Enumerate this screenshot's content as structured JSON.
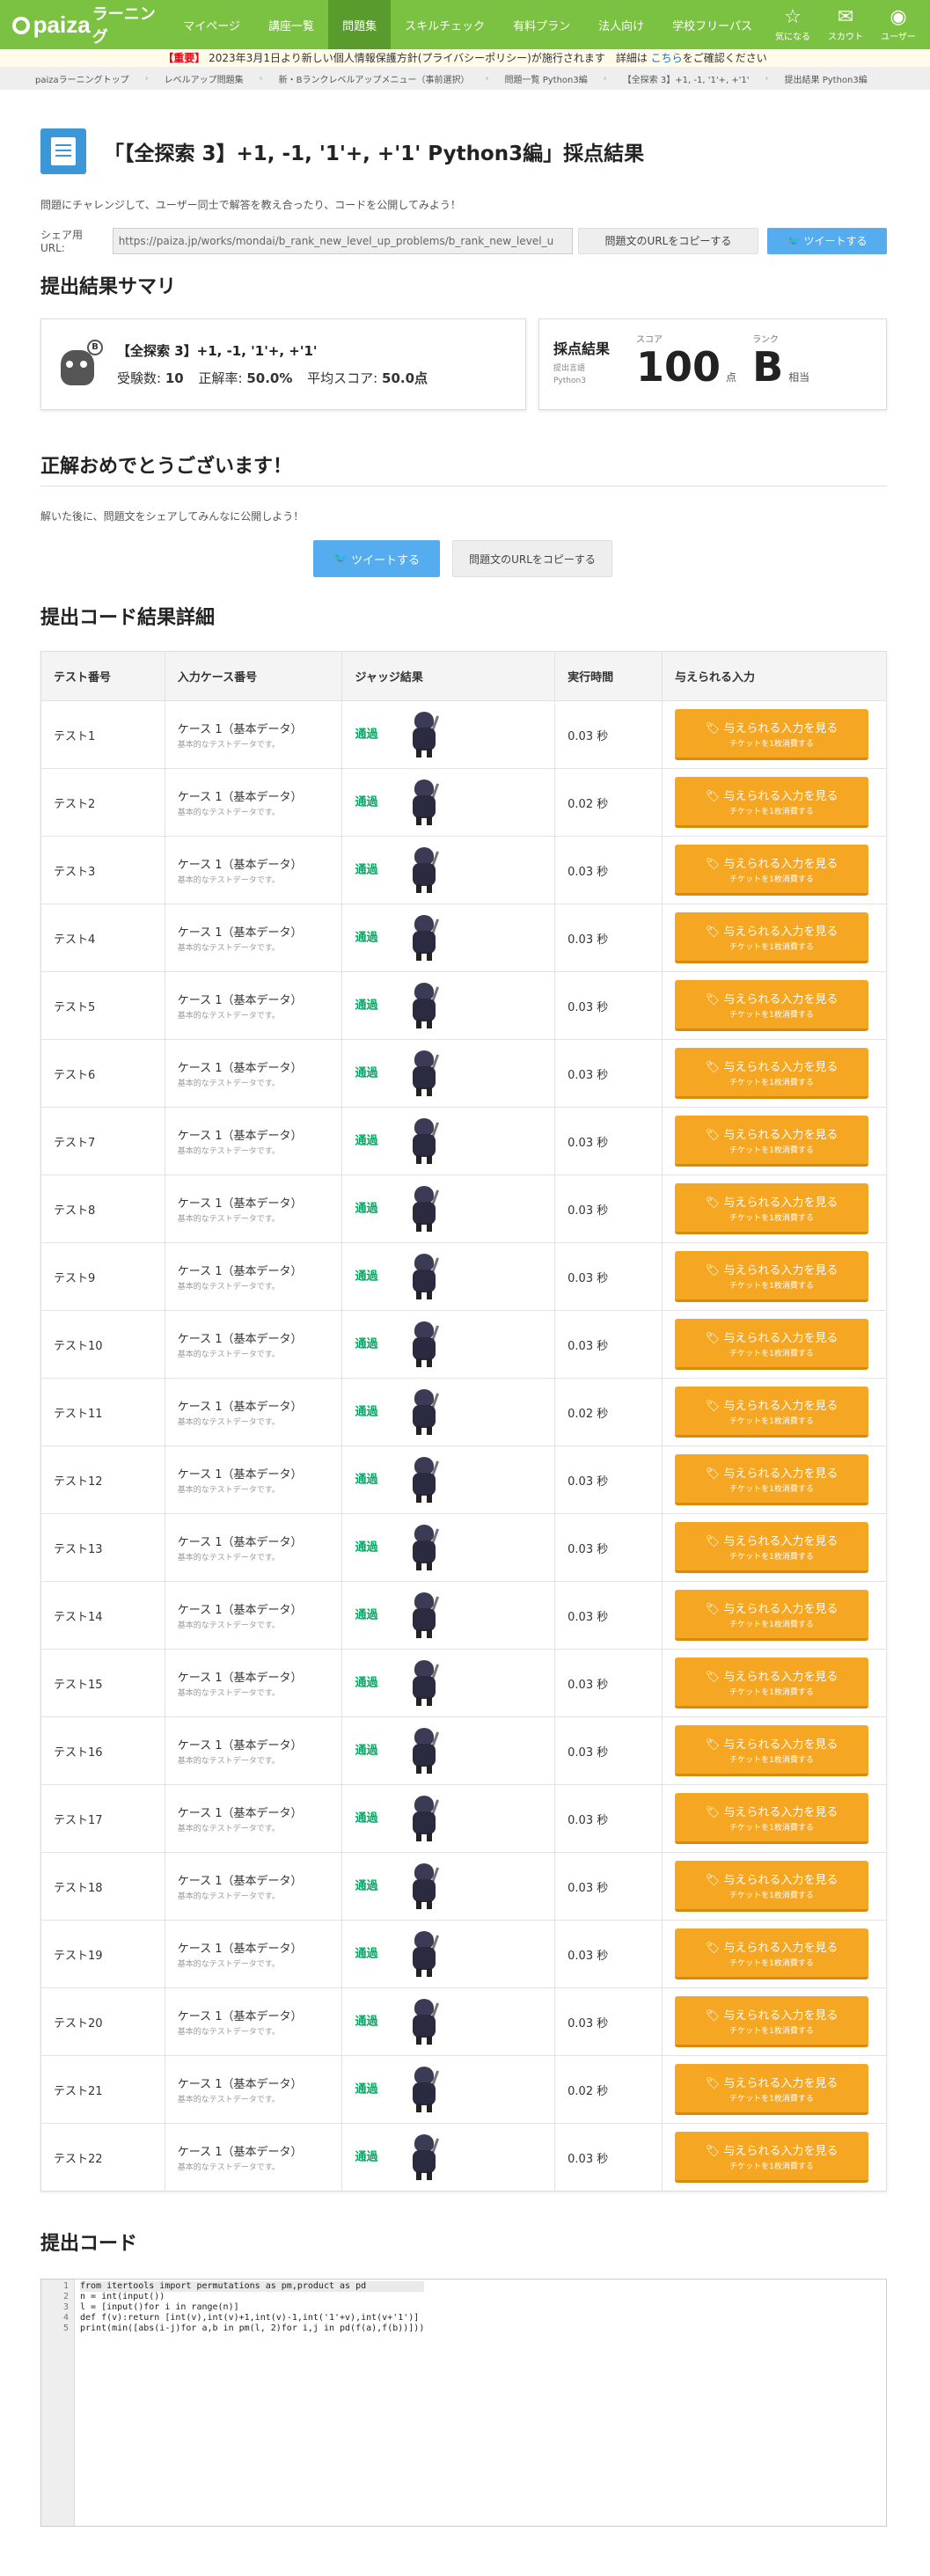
{
  "nav": {
    "logo_main": "paiza",
    "logo_sub": "ラーニング",
    "links": [
      "マイページ",
      "講座一覧",
      "問題集",
      "スキルチェック",
      "有料プラン",
      "法人向け",
      "学校フリーパス"
    ],
    "active": "問題集",
    "icons": [
      {
        "label": "気になる",
        "icon": "star-icon"
      },
      {
        "label": "スカウト",
        "icon": "mail-icon"
      },
      {
        "label": "ユーザー",
        "icon": "user-icon"
      }
    ]
  },
  "notice": {
    "important": "【重要】",
    "text": "2023年3月1日より新しい個人情報保護方針(プライバシーポリシー)が施行されます　詳細は",
    "link": "こちら",
    "tail": "をご確認ください"
  },
  "breadcrumb": [
    "paizaラーニングトップ",
    "レベルアップ問題集",
    "新・Bランクレベルアップメニュー（事前選択）",
    "問題一覧 Python3編",
    "【全探索 3】+1, -1, '1'+, +'1'",
    "提出結果 Python3編"
  ],
  "page_title": "「【全探索 3】+1, -1, '1'+, +'1' Python3編」採点結果",
  "lead": "問題にチャレンジして、ユーザー同士で解答を教え合ったり、コードを公開してみよう！",
  "share": {
    "label": "シェア用URL:",
    "url": "https://paiza.jp/works/mondai/b_rank_new_level_up_problems/b_rank_new_level_u",
    "copy": "問題文のURLをコピーする",
    "tweet": "ツイートする"
  },
  "summary": {
    "heading": "提出結果サマリ",
    "problem": "【全探索 3】+1, -1, '1'+, +'1'",
    "rank_badge": "B",
    "takers_label": "受験数:",
    "takers": "10",
    "rate_label": "正解率:",
    "rate": "50.0%",
    "avg_label": "平均スコア:",
    "avg": "50.0点",
    "result_label": "採点結果",
    "lang_label": "提出言語",
    "lang": "Python3",
    "score_label": "スコア",
    "score": "100",
    "score_unit": "点",
    "rank_label": "ランク",
    "rank": "B",
    "rank_unit": "相当"
  },
  "congrats": {
    "heading": "正解おめでとうございます！",
    "msg": "解いた後に、問題文をシェアしてみんなに公開しよう！",
    "tweet": "ツイートする",
    "copy": "問題文のURLをコピーする"
  },
  "results": {
    "heading": "提出コード結果詳細",
    "columns": [
      "テスト番号",
      "入力ケース番号",
      "ジャッジ結果",
      "実行時間",
      "与えられる入力"
    ],
    "rows": [
      {
        "test": "テスト1",
        "case": "ケース 1（基本データ）",
        "desc": "基本的なテストデータです。",
        "judge": "通過",
        "time": "0.03 秒"
      },
      {
        "test": "テスト2",
        "case": "ケース 1（基本データ）",
        "desc": "基本的なテストデータです。",
        "judge": "通過",
        "time": "0.02 秒"
      },
      {
        "test": "テスト3",
        "case": "ケース 1（基本データ）",
        "desc": "基本的なテストデータです。",
        "judge": "通過",
        "time": "0.03 秒"
      },
      {
        "test": "テスト4",
        "case": "ケース 1（基本データ）",
        "desc": "基本的なテストデータです。",
        "judge": "通過",
        "time": "0.03 秒"
      },
      {
        "test": "テスト5",
        "case": "ケース 1（基本データ）",
        "desc": "基本的なテストデータです。",
        "judge": "通過",
        "time": "0.03 秒"
      },
      {
        "test": "テスト6",
        "case": "ケース 1（基本データ）",
        "desc": "基本的なテストデータです。",
        "judge": "通過",
        "time": "0.03 秒"
      },
      {
        "test": "テスト7",
        "case": "ケース 1（基本データ）",
        "desc": "基本的なテストデータです。",
        "judge": "通過",
        "time": "0.03 秒"
      },
      {
        "test": "テスト8",
        "case": "ケース 1（基本データ）",
        "desc": "基本的なテストデータです。",
        "judge": "通過",
        "time": "0.03 秒"
      },
      {
        "test": "テスト9",
        "case": "ケース 1（基本データ）",
        "desc": "基本的なテストデータです。",
        "judge": "通過",
        "time": "0.03 秒"
      },
      {
        "test": "テスト10",
        "case": "ケース 1（基本データ）",
        "desc": "基本的なテストデータです。",
        "judge": "通過",
        "time": "0.03 秒"
      },
      {
        "test": "テスト11",
        "case": "ケース 1（基本データ）",
        "desc": "基本的なテストデータです。",
        "judge": "通過",
        "time": "0.02 秒"
      },
      {
        "test": "テスト12",
        "case": "ケース 1（基本データ）",
        "desc": "基本的なテストデータです。",
        "judge": "通過",
        "time": "0.03 秒"
      },
      {
        "test": "テスト13",
        "case": "ケース 1（基本データ）",
        "desc": "基本的なテストデータです。",
        "judge": "通過",
        "time": "0.03 秒"
      },
      {
        "test": "テスト14",
        "case": "ケース 1（基本データ）",
        "desc": "基本的なテストデータです。",
        "judge": "通過",
        "time": "0.03 秒"
      },
      {
        "test": "テスト15",
        "case": "ケース 1（基本データ）",
        "desc": "基本的なテストデータです。",
        "judge": "通過",
        "time": "0.03 秒"
      },
      {
        "test": "テスト16",
        "case": "ケース 1（基本データ）",
        "desc": "基本的なテストデータです。",
        "judge": "通過",
        "time": "0.03 秒"
      },
      {
        "test": "テスト17",
        "case": "ケース 1（基本データ）",
        "desc": "基本的なテストデータです。",
        "judge": "通過",
        "time": "0.03 秒"
      },
      {
        "test": "テスト18",
        "case": "ケース 1（基本データ）",
        "desc": "基本的なテストデータです。",
        "judge": "通過",
        "time": "0.03 秒"
      },
      {
        "test": "テスト19",
        "case": "ケース 1（基本データ）",
        "desc": "基本的なテストデータです。",
        "judge": "通過",
        "time": "0.03 秒"
      },
      {
        "test": "テスト20",
        "case": "ケース 1（基本データ）",
        "desc": "基本的なテストデータです。",
        "judge": "通過",
        "time": "0.03 秒"
      },
      {
        "test": "テスト21",
        "case": "ケース 1（基本データ）",
        "desc": "基本的なテストデータです。",
        "judge": "通過",
        "time": "0.02 秒"
      },
      {
        "test": "テスト22",
        "case": "ケース 1（基本データ）",
        "desc": "基本的なテストデータです。",
        "judge": "通過",
        "time": "0.03 秒"
      }
    ],
    "view_btn": "与えられる入力を見る",
    "view_sub": "チケットを1枚消費する"
  },
  "code": {
    "heading": "提出コード",
    "lines": [
      "from itertools import permutations as pm,product as pd",
      "n = int(input())",
      "l = [input()for i in range(n)]",
      "def f(v):return [int(v),int(v)+1,int(v)-1,int('1'+v),int(v+'1')]",
      "print(min([abs(i-j)for a,b in pm(l, 2)for i,j in pd(f(a),f(b))]))"
    ]
  },
  "colors": {
    "brand": "#7cc242",
    "accent": "#f5a623",
    "twitter": "#55acee",
    "pass": "#00a862"
  }
}
